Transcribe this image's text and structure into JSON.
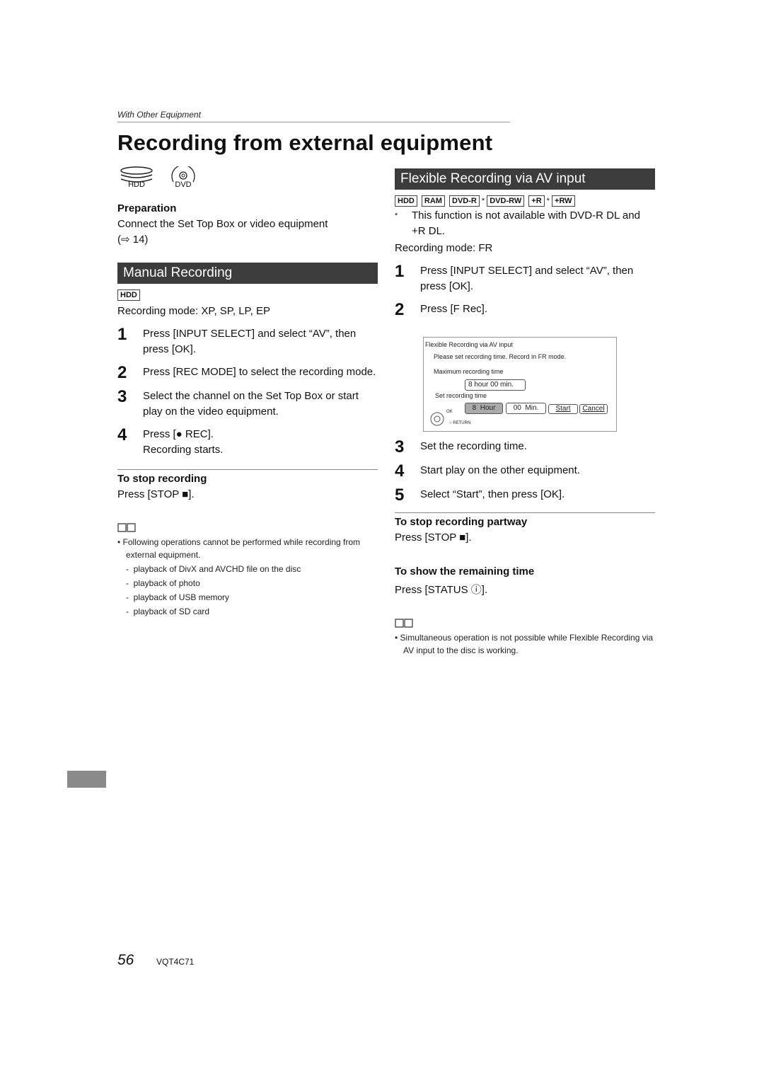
{
  "header": {
    "section": "With Other Equipment",
    "title": "Recording from external equipment",
    "disc_icons": [
      "HDD",
      "DVD"
    ]
  },
  "left": {
    "preparation": {
      "heading": "Preparation",
      "text": "Connect the Set Top Box or video equipment",
      "ref": "(⇨ 14)"
    },
    "manual": {
      "heading": "Manual Recording",
      "badge": "HDD",
      "mode": "Recording mode: XP, SP, LP, EP",
      "steps": [
        {
          "num": "1",
          "text": "Press [INPUT SELECT] and select “AV”, then press [OK]."
        },
        {
          "num": "2",
          "text": "Press [REC MODE] to select the recording mode."
        },
        {
          "num": "3",
          "text": "Select the channel on the Set Top Box or start play on the video equipment."
        },
        {
          "num": "4",
          "text": "Press [● REC].",
          "sub": "Recording starts."
        }
      ],
      "stop_heading": "To stop recording",
      "stop_text": "Press [STOP ■].",
      "note_bullet": "Following operations cannot be performed while recording from external equipment.",
      "note_items": [
        "playback of DivX and AVCHD file on the disc",
        "playback of photo",
        "playback of USB memory",
        "playback of SD card"
      ]
    }
  },
  "right": {
    "heading": "Flexible Recording via AV input",
    "badges": [
      "HDD",
      "RAM",
      "DVD-R",
      "DVD-RW",
      "+R",
      "+RW"
    ],
    "footnote_mark": "*",
    "footnote": "This function is not available with DVD-R DL and +R DL.",
    "mode": "Recording mode: FR",
    "steps_a": [
      {
        "num": "1",
        "text": "Press [INPUT SELECT] and select “AV”, then press [OK]."
      },
      {
        "num": "2",
        "text": "Press [F Rec]."
      }
    ],
    "screen": {
      "title": "Flexible Recording via AV input",
      "message": "Please set recording time. Record in FR mode.",
      "max_label": "Maximum recording time",
      "max_value": "8 hour 00 min.",
      "set_label": "Set recording time",
      "hour_value": "8",
      "hour_label": "Hour",
      "min_value": "00",
      "min_label": "Min.",
      "start": "Start",
      "cancel": "Cancel",
      "ok": "OK",
      "return": "RETURN"
    },
    "steps_b": [
      {
        "num": "3",
        "text": "Set the recording time."
      },
      {
        "num": "4",
        "text": "Start play on the other equipment."
      },
      {
        "num": "5",
        "text": "Select “Start”, then press [OK]."
      }
    ],
    "stop_heading": "To stop recording partway",
    "stop_text": "Press [STOP ■].",
    "remain_heading": "To show the remaining time",
    "remain_text": "Press [STATUS ⓘ].",
    "note_bullet": "Simultaneous operation is not possible while Flexible Recording via AV input to the disc is working."
  },
  "footer": {
    "page_number": "56",
    "doc_code": "VQT4C71"
  }
}
